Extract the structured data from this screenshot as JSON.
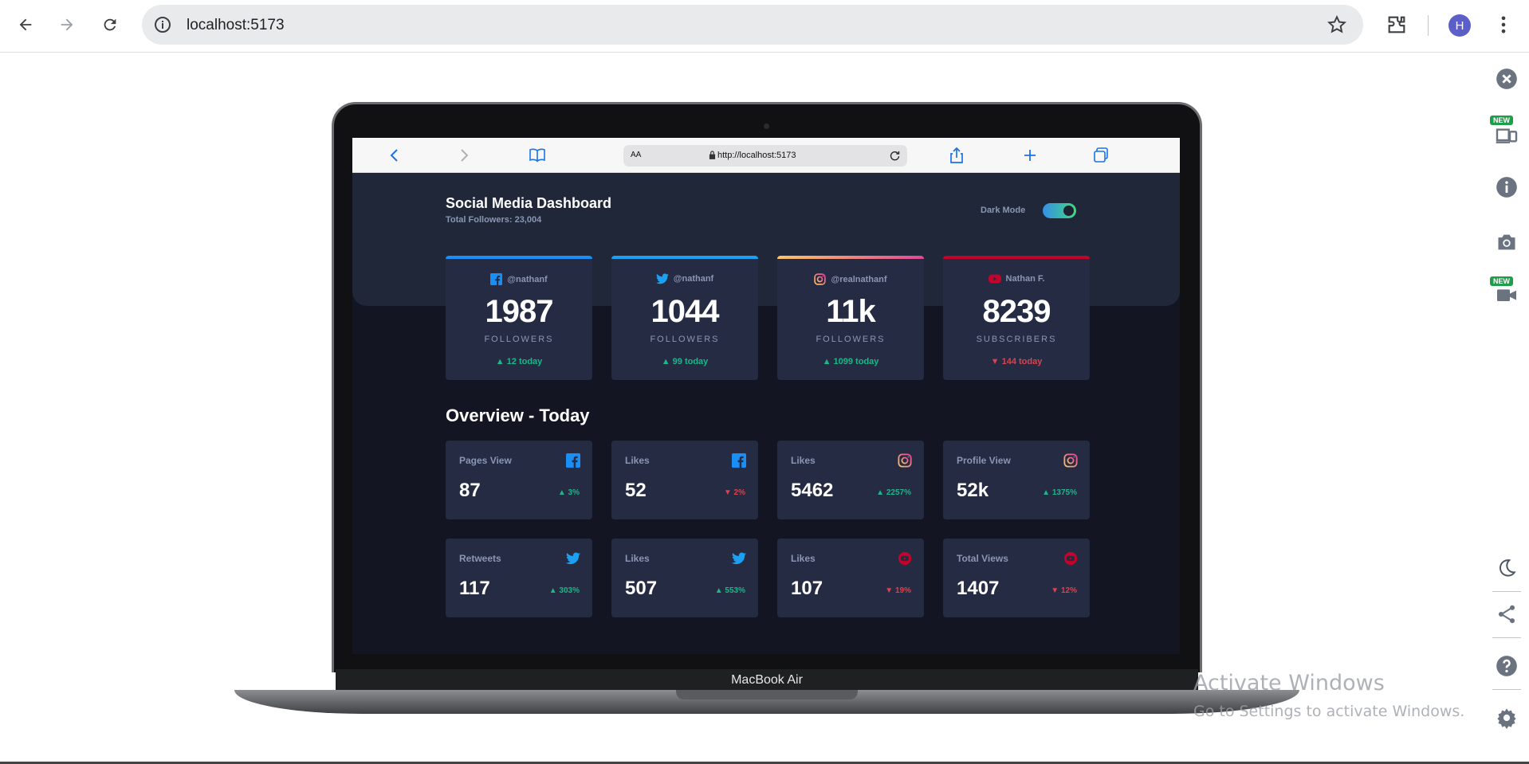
{
  "browser": {
    "url": "localhost:5173",
    "avatar_letter": "H"
  },
  "right_toolbar": {
    "new_badge_1": "NEW",
    "new_badge_2": "NEW"
  },
  "laptop": {
    "label": "MacBook Air"
  },
  "safari": {
    "aa": "AA",
    "url": "http://localhost:5173"
  },
  "dashboard": {
    "title": "Social Media Dashboard",
    "subtitle": "Total Followers: 23,004",
    "dark_mode_label": "Dark Mode",
    "dark_mode_on": true,
    "overview_title": "Overview - Today",
    "followers": [
      {
        "platform": "facebook",
        "handle": "@nathanf",
        "count": "1987",
        "unit": "FOLLOWERS",
        "delta": "12 today",
        "trend": "up",
        "color": "#198ff5"
      },
      {
        "platform": "twitter",
        "handle": "@nathanf",
        "count": "1044",
        "unit": "FOLLOWERS",
        "delta": "99 today",
        "trend": "up",
        "color": "#1ca0f2"
      },
      {
        "platform": "instagram",
        "handle": "@realnathanf",
        "count": "11k",
        "unit": "FOLLOWERS",
        "delta": "1099 today",
        "trend": "up",
        "color": "#e1306c"
      },
      {
        "platform": "youtube",
        "handle": "Nathan F.",
        "count": "8239",
        "unit": "SUBSCRIBERS",
        "delta": "144 today",
        "trend": "down",
        "color": "#c4032b"
      }
    ],
    "overview": [
      {
        "label": "Pages View",
        "platform": "facebook",
        "value": "87",
        "delta": "3%",
        "trend": "up"
      },
      {
        "label": "Likes",
        "platform": "facebook",
        "value": "52",
        "delta": "2%",
        "trend": "down"
      },
      {
        "label": "Likes",
        "platform": "instagram",
        "value": "5462",
        "delta": "2257%",
        "trend": "up"
      },
      {
        "label": "Profile View",
        "platform": "instagram",
        "value": "52k",
        "delta": "1375%",
        "trend": "up"
      },
      {
        "label": "Retweets",
        "platform": "twitter",
        "value": "117",
        "delta": "303%",
        "trend": "up"
      },
      {
        "label": "Likes",
        "platform": "twitter",
        "value": "507",
        "delta": "553%",
        "trend": "up"
      },
      {
        "label": "Likes",
        "platform": "youtube",
        "value": "107",
        "delta": "19%",
        "trend": "down"
      },
      {
        "label": "Total Views",
        "platform": "youtube",
        "value": "1407",
        "delta": "12%",
        "trend": "down"
      }
    ]
  },
  "watermark": {
    "line1": "Activate Windows",
    "line2": "Go to Settings to activate Windows."
  }
}
